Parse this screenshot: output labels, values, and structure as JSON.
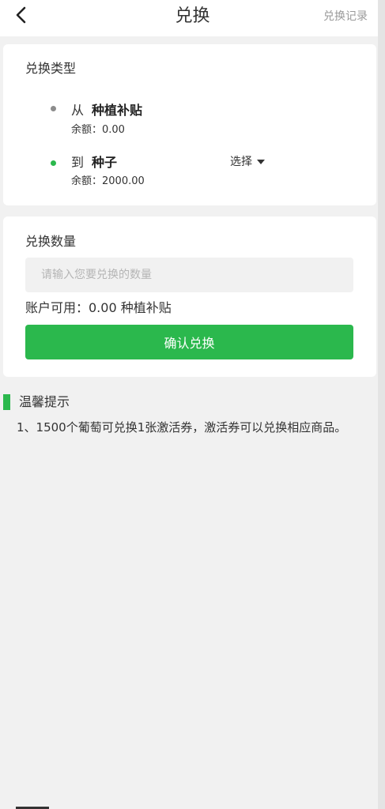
{
  "header": {
    "title": "兑换",
    "record_link": "兑换记录"
  },
  "exchange_type": {
    "heading": "兑换类型",
    "from": {
      "direction": "从",
      "name": "种植补贴",
      "balance": "余额：0.00"
    },
    "to": {
      "direction": "到",
      "name": "种子",
      "balance": "余额：2000.00",
      "select_label": "选择"
    }
  },
  "exchange_amount": {
    "heading": "兑换数量",
    "input_value": "",
    "input_placeholder": "请输入您要兑换的数量",
    "available": "账户可用：0.00 种植补贴",
    "confirm_label": "确认兑换"
  },
  "tips": {
    "title": "温馨提示",
    "text": "1、1500个葡萄可兑换1张激活券，激活券可以兑换相应商品。"
  },
  "colors": {
    "accent_green": "#2bb84d",
    "from_dot": "#8c8c8c",
    "to_dot": "#2bb84d"
  },
  "icons": {
    "back": "chevron-left-icon",
    "select_caret": "caret-down-icon"
  }
}
